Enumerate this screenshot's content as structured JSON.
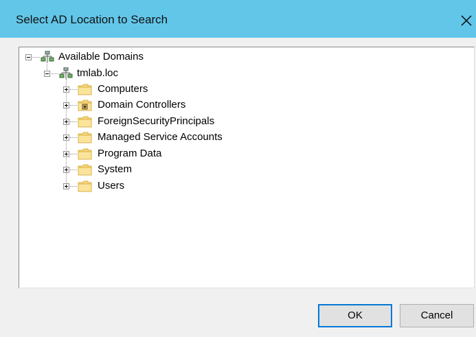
{
  "window": {
    "title": "Select AD Location to Search",
    "close_icon": "close-icon"
  },
  "tree": {
    "root": {
      "label": "Available Domains",
      "icon": "domain-tree-icon",
      "expanded": true
    },
    "domain": {
      "label": "tmlab.loc",
      "icon": "domain-icon",
      "expanded": true
    },
    "containers": [
      {
        "label": "Computers",
        "icon": "folder-icon"
      },
      {
        "label": "Domain Controllers",
        "icon": "ou-folder-icon"
      },
      {
        "label": "ForeignSecurityPrincipals",
        "icon": "folder-icon"
      },
      {
        "label": "Managed Service Accounts",
        "icon": "folder-icon"
      },
      {
        "label": "Program Data",
        "icon": "folder-icon"
      },
      {
        "label": "System",
        "icon": "folder-icon"
      },
      {
        "label": "Users",
        "icon": "folder-icon"
      }
    ]
  },
  "buttons": {
    "ok_label": "OK",
    "cancel_label": "Cancel"
  },
  "colors": {
    "titlebar": "#62c6e9",
    "dialog_bg": "#f0f0f0",
    "folder": "#f8d775",
    "default_button_border": "#0078d7"
  }
}
